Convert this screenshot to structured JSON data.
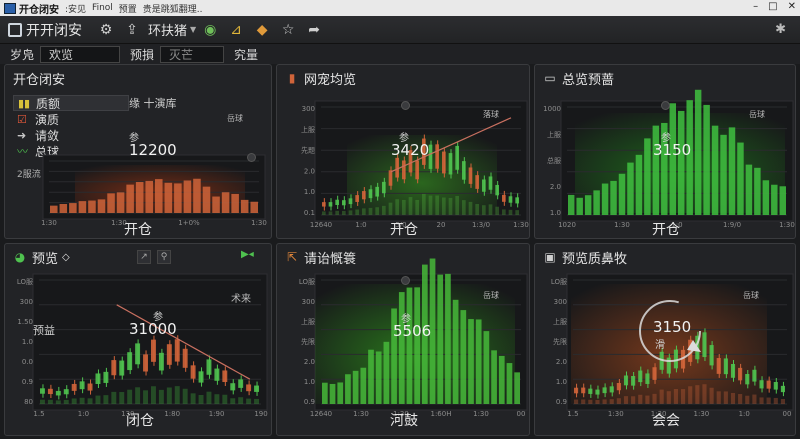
{
  "window": {
    "app_name": "开仓闭安",
    "menus": [
      ":安见",
      "Finol",
      "预置",
      "贵是跳狐翻理.."
    ],
    "controls": [
      "–",
      "□",
      "✕"
    ]
  },
  "toolbar": {
    "title": "开开闭安",
    "selector_label": "环扶猪",
    "icons": [
      "gear-icon",
      "upload-icon",
      "globe-icon",
      "chart-icon",
      "box-icon",
      "star-icon",
      "share-icon",
      "pin-icon"
    ]
  },
  "filters": {
    "label1": "岁凫",
    "value1": "欢览",
    "label2": "预損",
    "value2": "灭芒",
    "label3": "究量"
  },
  "panels": [
    {
      "id": "p1",
      "title": "开仓闭安",
      "tab": "缘 十演库",
      "legend": [
        {
          "icon": "bars-icon",
          "label": "质额",
          "color": "#d9c23a"
        },
        {
          "icon": "check-icon",
          "label": "演质",
          "color": "#e0573a"
        },
        {
          "icon": "arrow-icon",
          "label": "请敛",
          "color": "#c7c7c7"
        },
        {
          "icon": "wave-icon",
          "label": "总球",
          "color": "#4fc24f"
        }
      ],
      "small_label": "2服流",
      "kpi_label": "参",
      "kpi": "12200",
      "note": "岳球",
      "footer": "开仓",
      "xticks": [
        "1:30",
        "1:30",
        "1+0%",
        "1:30"
      ],
      "yticks": [],
      "bar_color": "#d0643a",
      "glow": "#7a2e16"
    },
    {
      "id": "p2",
      "title": "网宠均览",
      "kpi_label": "参",
      "kpi": "3420",
      "note": "落球",
      "footer": "开仓",
      "yticks": [
        "300",
        "上服",
        "先题",
        "2.0",
        "1.0",
        "0.1"
      ],
      "xticks": [
        "12640",
        "1:0",
        "5/0",
        "20",
        "1:3/0",
        "1:30"
      ],
      "bar_color": "#4fa83c",
      "glow": "#2c6a1e"
    },
    {
      "id": "p3",
      "title": "总览预蔷",
      "kpi_label": "参",
      "kpi": "3150",
      "note": "岳球",
      "footer": "开仓",
      "yticks": [
        "1000",
        "上服",
        "总服",
        "2.0",
        "1.0"
      ],
      "xticks": [
        "1020",
        "1:30",
        "1:0",
        "1:9/0",
        "1:30"
      ],
      "bar_color": "#3fbf3f",
      "glow": "#1f6a1c"
    },
    {
      "id": "p4",
      "title": "预览",
      "header_suffix": "◇",
      "small_label": "预益",
      "kpi_label": "参",
      "kpi": "31000",
      "note": "术来",
      "footer": "闭仓",
      "yticks": [
        "LO服",
        "300",
        "1.50",
        "1.0",
        "0.0",
        "0.9",
        "80"
      ],
      "xticks": [
        "1.5",
        "1:0",
        "130",
        "1:80",
        "1:90",
        "190"
      ],
      "bar_color": "#3fae3f",
      "glow": "#1d1e20"
    },
    {
      "id": "p5",
      "title": "请诒慨簑",
      "kpi_label": "参",
      "kpi": "5506",
      "note": "岳球",
      "footer": "河鼓",
      "yticks": [
        "LO服",
        "300",
        "上服",
        "先限",
        "2.0",
        "1.0",
        "0.9"
      ],
      "xticks": [
        "12640",
        "1:30",
        "1:30",
        "1:60H",
        "1:30",
        "00"
      ],
      "bar_color": "#47b83a",
      "glow": "#2a7a1c"
    },
    {
      "id": "p6",
      "title": "预览质鼻牧",
      "kpi_label": "滑",
      "kpi": "3150",
      "note": "岳球",
      "footer": "会会",
      "yticks": [
        "LO服",
        "300",
        "上服",
        "先限",
        "2.0",
        "1.0",
        "0.9"
      ],
      "xticks": [
        "1.5",
        "1:30",
        "1:30",
        "1:30",
        "1:0",
        "00"
      ],
      "bar_color": "#c9603a",
      "glow": "#7a3a1c"
    }
  ],
  "colors": {
    "up": "#4fc24f",
    "down": "#d0643a",
    "trend": "#c97060"
  }
}
